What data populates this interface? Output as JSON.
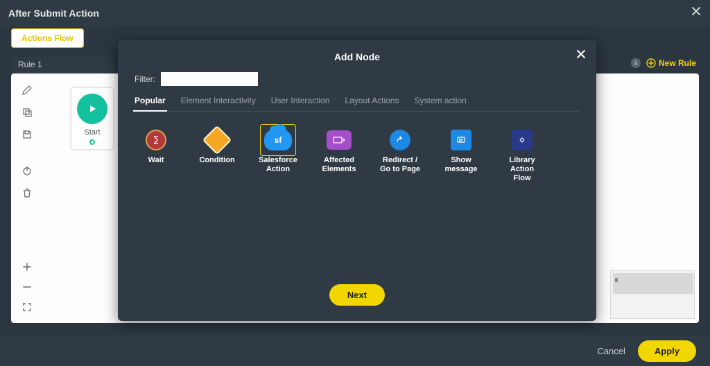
{
  "header": {
    "title": "After Submit Action"
  },
  "tabbar": {
    "actions_flow": "Actions Flow"
  },
  "rule_tab": {
    "label": "Rule 1"
  },
  "new_rule": {
    "label": "New Rule",
    "badge": "i"
  },
  "start_node": {
    "label": "Start"
  },
  "modal": {
    "title": "Add Node",
    "filter_label": "Filter:",
    "filter_value": "",
    "tabs": {
      "popular": "Popular",
      "element_interactivity": "Element Interactivity",
      "user_interaction": "User Interaction",
      "layout_actions": "Layout Actions",
      "system_action": "System action"
    },
    "nodes": {
      "wait": "Wait",
      "condition": "Condition",
      "salesforce_action": "Salesforce Action",
      "affected_elements": "Affected Elements",
      "redirect_goto": "Redirect / Go to Page",
      "show_message": "Show message",
      "library_action_flow": "Library Action Flow"
    },
    "next": "Next"
  },
  "footer": {
    "cancel": "Cancel",
    "apply": "Apply"
  }
}
